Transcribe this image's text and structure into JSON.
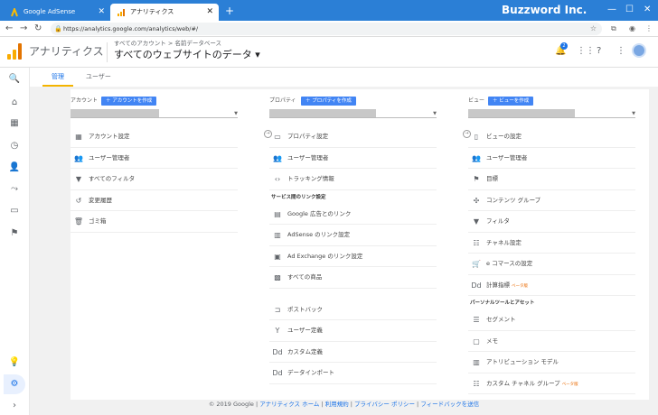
{
  "browser": {
    "tabs": [
      {
        "title": "Google AdSense"
      },
      {
        "title": "アナリティクス"
      }
    ],
    "new_tab": "+",
    "brand": "Buzzword Inc.",
    "url": "https://analytics.google.com/analytics/web/#/"
  },
  "app": {
    "name": "アナリティクス",
    "breadcrumb": "すべてのアカウント > 名前データベース",
    "property": "すべてのウェブサイトのデータ ▾",
    "notification_count": "2"
  },
  "tabs": {
    "admin": "管理",
    "user": "ユーザー"
  },
  "account": {
    "header": "アカウント",
    "create_btn": "＋ アカウントを作成",
    "items": [
      {
        "icon": "building-icon",
        "glyph": "▦",
        "label": "アカウント設定"
      },
      {
        "icon": "users-icon",
        "glyph": "👥",
        "label": "ユーザー管理者"
      },
      {
        "icon": "filter-icon",
        "glyph": "▼",
        "label": "すべてのフィルタ"
      },
      {
        "icon": "history-icon",
        "glyph": "↺",
        "label": "変更履歴"
      },
      {
        "icon": "trash-icon",
        "glyph": "🗑",
        "label": "ゴミ箱"
      }
    ]
  },
  "property": {
    "header": "プロパティ",
    "create_btn": "＋ プロパティを作成",
    "items": [
      {
        "icon": "property-settings-icon",
        "glyph": "▭",
        "label": "プロパティ設定"
      },
      {
        "icon": "users-icon",
        "glyph": "👥",
        "label": "ユーザー管理者"
      },
      {
        "icon": "code-icon",
        "glyph": "‹›",
        "label": "トラッキング情報"
      }
    ],
    "section": "サービス間のリンク設定",
    "link_items": [
      {
        "icon": "ads-icon",
        "glyph": "▤",
        "label": "Google 広告とのリンク"
      },
      {
        "icon": "adsense-icon",
        "glyph": "▥",
        "label": "AdSense のリンク設定"
      },
      {
        "icon": "adexchange-icon",
        "glyph": "▣",
        "label": "Ad Exchange のリンク設定"
      },
      {
        "icon": "products-icon",
        "glyph": "▩",
        "label": "すべての商品"
      }
    ],
    "more_items": [
      {
        "icon": "postback-icon",
        "glyph": "⊐",
        "label": "ポストバック"
      },
      {
        "icon": "custom-def-icon",
        "glyph": "Y",
        "label": "ユーザー定義"
      },
      {
        "icon": "dd-icon",
        "glyph": "Dd",
        "label": "カスタム定義"
      },
      {
        "icon": "dd-icon",
        "glyph": "Dd",
        "label": "データインポート"
      }
    ]
  },
  "view": {
    "header": "ビュー",
    "create_btn": "＋ ビューを作成",
    "items": [
      {
        "icon": "doc-icon",
        "glyph": "▯",
        "label": "ビューの設定",
        "beta": ""
      },
      {
        "icon": "users-icon",
        "glyph": "👥",
        "label": "ユーザー管理者",
        "beta": ""
      },
      {
        "icon": "flag-icon",
        "glyph": "⚑",
        "label": "目標",
        "beta": ""
      },
      {
        "icon": "group-icon",
        "glyph": "✣",
        "label": "コンテンツ グループ",
        "beta": ""
      },
      {
        "icon": "filter-icon",
        "glyph": "▼",
        "label": "フィルタ",
        "beta": ""
      },
      {
        "icon": "channel-icon",
        "glyph": "☷",
        "label": "チャネル設定",
        "beta": ""
      },
      {
        "icon": "cart-icon",
        "glyph": "🛒",
        "label": "e コマースの設定",
        "beta": ""
      },
      {
        "icon": "dd-icon",
        "glyph": "Dd",
        "label": "計算指標",
        "beta": "ベータ版"
      }
    ],
    "section": "パーソナルツールとアセット",
    "tool_items": [
      {
        "icon": "segment-icon",
        "glyph": "☰",
        "label": "セグメント",
        "beta": ""
      },
      {
        "icon": "memo-icon",
        "glyph": "▢",
        "label": "メモ",
        "beta": ""
      },
      {
        "icon": "attribution-icon",
        "glyph": "▥",
        "label": "アトリビューション モデル",
        "beta": ""
      },
      {
        "icon": "channel-group-icon",
        "glyph": "☷",
        "label": "カスタム チャネル グループ",
        "beta": "ベータ版"
      }
    ]
  },
  "footer": {
    "copyright": "© 2019 Google | ",
    "links": [
      "アナリティクス ホーム",
      "利用規約",
      "プライバシー ポリシー",
      "フィードバックを送信"
    ]
  },
  "colors": {
    "accent": "#1a73e8",
    "titlebar": "#2b7fd6",
    "logo": "#f9ab00"
  }
}
